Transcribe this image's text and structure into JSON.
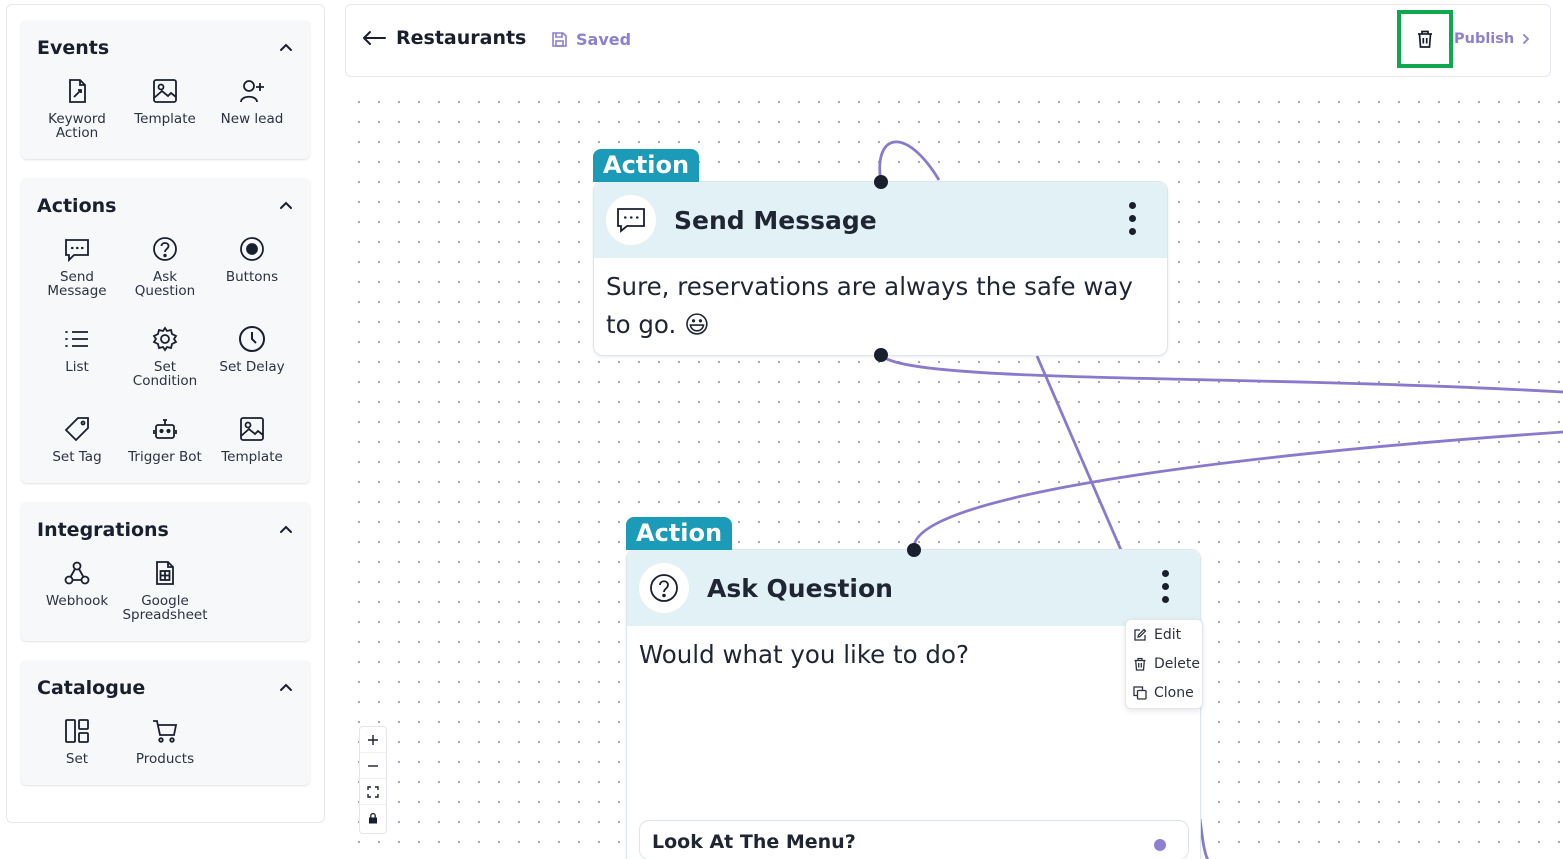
{
  "sidebar": {
    "events": {
      "title": "Events",
      "items": [
        {
          "label": "Keyword\nAction",
          "icon": "keyword-action-icon"
        },
        {
          "label": "Template",
          "icon": "image-icon"
        },
        {
          "label": "New lead",
          "icon": "user-plus-icon"
        }
      ]
    },
    "actions": {
      "title": "Actions",
      "items": [
        {
          "label": "Send\nMessage",
          "icon": "message-icon"
        },
        {
          "label": "Ask\nQuestion",
          "icon": "question-icon"
        },
        {
          "label": "Buttons",
          "icon": "radio-button-icon"
        },
        {
          "label": "List",
          "icon": "list-icon"
        },
        {
          "label": "Set\nCondition",
          "icon": "gear-icon"
        },
        {
          "label": "Set Delay",
          "icon": "clock-icon"
        },
        {
          "label": "Set Tag",
          "icon": "tag-icon"
        },
        {
          "label": "Trigger Bot",
          "icon": "bot-icon"
        },
        {
          "label": "Template",
          "icon": "image-icon"
        }
      ]
    },
    "integrations": {
      "title": "Integrations",
      "items": [
        {
          "label": "Webhook",
          "icon": "webhook-icon"
        },
        {
          "label": "Google\nSpreadsheet",
          "icon": "spreadsheet-icon"
        }
      ]
    },
    "catalogue": {
      "title": "Catalogue",
      "items": [
        {
          "label": "Set",
          "icon": "grid-icon"
        },
        {
          "label": "Products",
          "icon": "cart-icon"
        }
      ]
    }
  },
  "header": {
    "title": "Restaurants",
    "saved_label": "Saved",
    "publish_label": "Publish"
  },
  "nodes": {
    "send_message": {
      "tag": "Action",
      "title": "Send Message",
      "body": "Sure, reservations are always the safe way to go. 😃"
    },
    "ask_question": {
      "tag": "Action",
      "title": "Ask Question",
      "body": "Would what you like to do?",
      "option": "Look At The Menu?"
    }
  },
  "context_menu": {
    "edit": "Edit",
    "delete": "Delete",
    "clone": "Clone"
  },
  "colors": {
    "accent": "#8f7fd0",
    "node_tag": "#1c9bb8",
    "node_header": "#e2f1f5",
    "highlight": "#10a84e"
  }
}
